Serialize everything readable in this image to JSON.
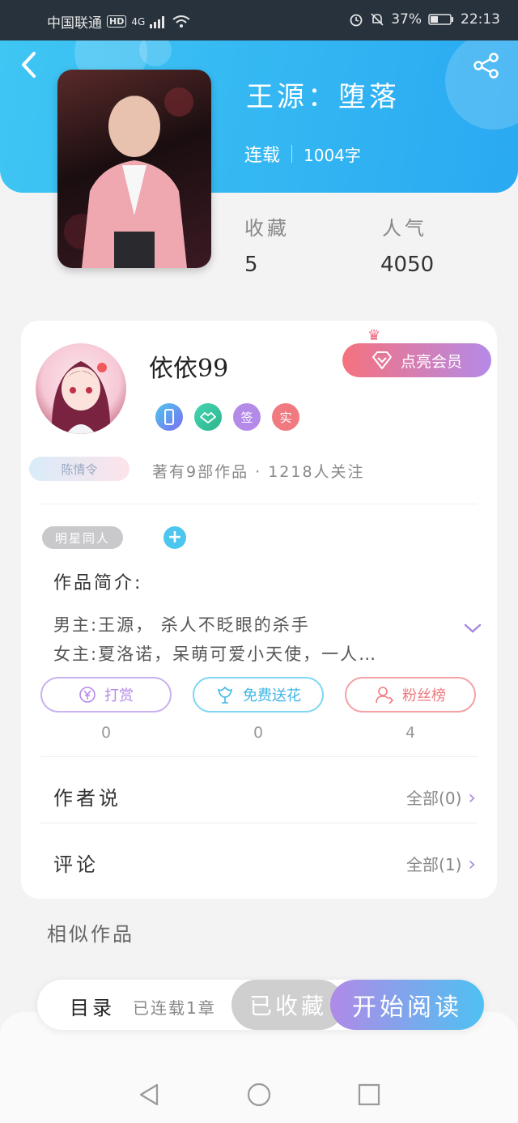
{
  "status_bar": {
    "carrier": "中国联通",
    "hd": "HD",
    "network": "4G",
    "battery": "37%",
    "time": "22:13"
  },
  "book": {
    "title": "王源：堕落",
    "status": "连载",
    "word_count": "1004字",
    "stats": [
      {
        "label": "收藏",
        "value": "5"
      },
      {
        "label": "人气",
        "value": "4050"
      }
    ]
  },
  "author": {
    "name": "依依99",
    "vip_button": "点亮会员",
    "badges": [
      "",
      "",
      "签",
      "实"
    ],
    "fan_tag": "陈情令",
    "meta": "著有9部作品 · 1218人关注"
  },
  "intro": {
    "genre_tag": "明星同人",
    "add_tag": "+",
    "heading": "作品简介:",
    "lines": [
      "男主:王源，  杀人不眨眼的杀手",
      "女主:夏洛诺，呆萌可爱小天使，一人…"
    ]
  },
  "actions": [
    {
      "label": "打赏",
      "count": "0",
      "color": "#b48ae8"
    },
    {
      "label": "免费送花",
      "count": "0",
      "color": "#4cc6ef"
    },
    {
      "label": "粉丝榜",
      "count": "4",
      "color": "#f07a80"
    }
  ],
  "sections": [
    {
      "title": "作者说",
      "link": "全部(0)"
    },
    {
      "title": "评论",
      "link": "全部(1)"
    }
  ],
  "similar_title": "相似作品",
  "bottom_bar": {
    "toc": "目录",
    "serial": "已连载1章",
    "favorite": "已收藏",
    "read": "开始阅读"
  }
}
